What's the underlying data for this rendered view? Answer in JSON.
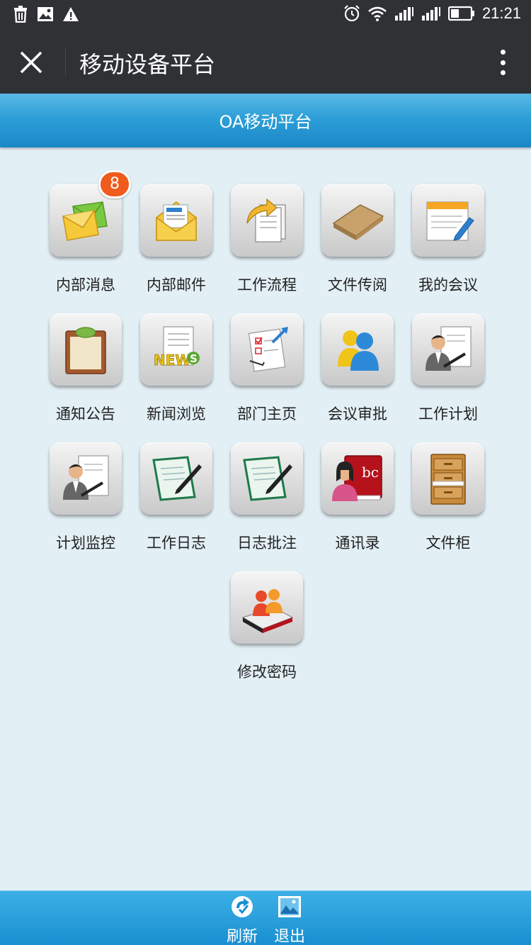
{
  "status_bar": {
    "time": "21:21",
    "left_icons": [
      "trash-icon",
      "image-icon",
      "warning-icon"
    ],
    "right_icons": [
      "alarm-icon",
      "wifi-icon",
      "signal-icon",
      "signal-icon",
      "battery-icon"
    ]
  },
  "title_bar": {
    "title": "移动设备平台",
    "close_icon": "close-icon",
    "more_icon": "more-vertical-icon"
  },
  "header": {
    "title": "OA移动平台"
  },
  "menu": {
    "items": [
      {
        "label": "内部消息",
        "icon": "envelopes-icon",
        "badge": "8"
      },
      {
        "label": "内部邮件",
        "icon": "open-mail-icon"
      },
      {
        "label": "工作流程",
        "icon": "workflow-docs-icon"
      },
      {
        "label": "文件传阅",
        "icon": "folder-icon"
      },
      {
        "label": "我的会议",
        "icon": "notepad-pen-icon"
      },
      {
        "label": "通知公告",
        "icon": "clipboard-icon"
      },
      {
        "label": "新闻浏览",
        "icon": "news-icon"
      },
      {
        "label": "部门主页",
        "icon": "checklist-icon"
      },
      {
        "label": "会议审批",
        "icon": "users-icon"
      },
      {
        "label": "工作计划",
        "icon": "person-document-icon"
      },
      {
        "label": "计划监控",
        "icon": "person-document-icon"
      },
      {
        "label": "工作日志",
        "icon": "log-pen-icon"
      },
      {
        "label": "日志批注",
        "icon": "log-pen-icon"
      },
      {
        "label": "通讯录",
        "icon": "address-book-icon"
      },
      {
        "label": "文件柜",
        "icon": "cabinet-icon"
      },
      {
        "label": "修改密码",
        "icon": "users-book-icon"
      }
    ]
  },
  "bottom_bar": {
    "refresh_label": "刷新",
    "logout_label": "退出"
  },
  "colors": {
    "status_bar_bg": "#2f3135",
    "header_blue": "#2d9fd8",
    "page_bg": "#e2eff5",
    "badge_orange": "#ee5b1c"
  }
}
